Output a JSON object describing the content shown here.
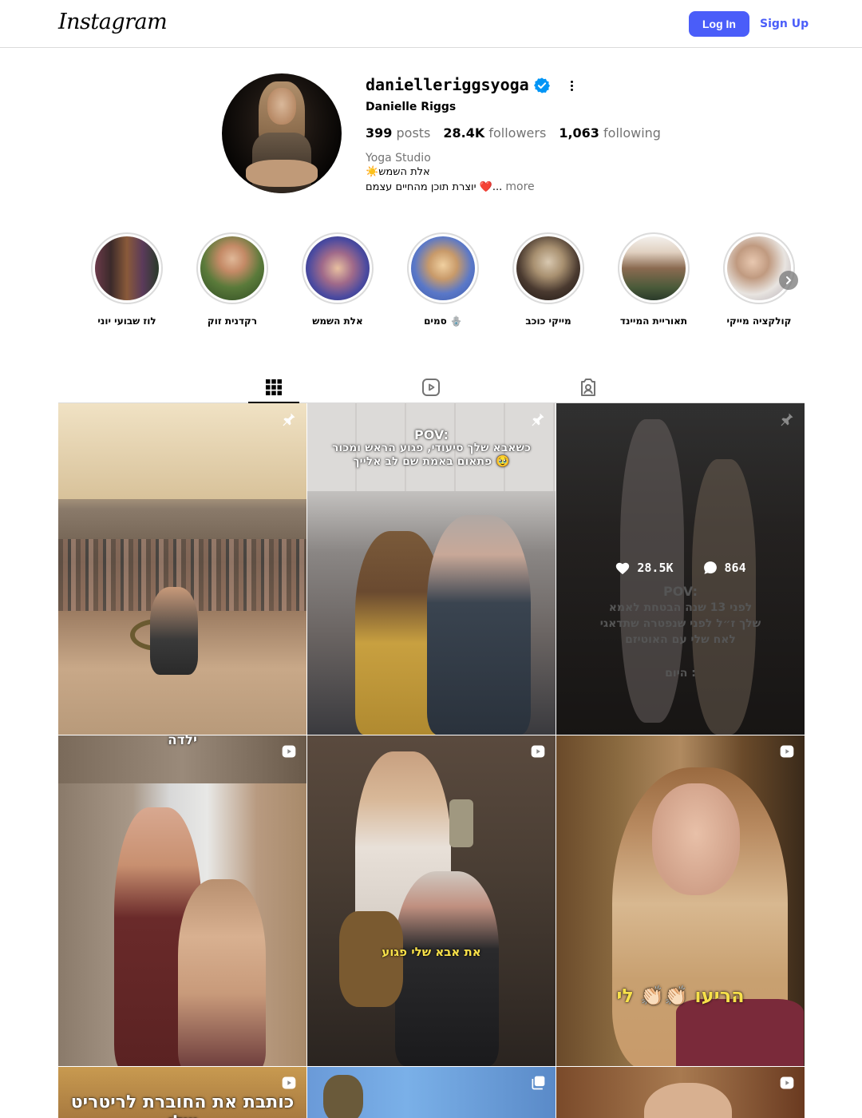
{
  "nav": {
    "logo": "Instagram",
    "login_label": "Log In",
    "signup_label": "Sign Up",
    "accent": "#4a5df9"
  },
  "profile": {
    "username": "danielleriggsyoga",
    "verified_icon": "verified-badge-icon",
    "full_name": "Danielle Riggs",
    "posts_count": "399",
    "posts_label": "posts",
    "followers_count": "28.4K",
    "followers_label": "followers",
    "following_count": "1,063",
    "following_label": "following",
    "category": "Yoga Studio",
    "bio_line1": "☀️אלת השמש",
    "bio_line2": "יוצרת תוכן מהחיים עצמם ❤️...",
    "bio_more": "more"
  },
  "highlights": [
    {
      "label": "לוז שבועי יוני"
    },
    {
      "label": "רקדנית זוק"
    },
    {
      "label": "אלת השמש"
    },
    {
      "label": "סמים 🪬"
    },
    {
      "label": "מייקי כוכב"
    },
    {
      "label": "תאוריית המיינד"
    },
    {
      "label": "קולקציה מייקי"
    }
  ],
  "tabs": [
    {
      "icon": "grid-icon",
      "active": true
    },
    {
      "icon": "reels-icon",
      "active": false
    },
    {
      "icon": "tagged-icon",
      "active": false
    }
  ],
  "posts": [
    {
      "type": "pinned",
      "overlay": ""
    },
    {
      "type": "pinned",
      "overlay_title": "POV:",
      "overlay": "כשאבא שלך סיעודי, פגוע הראש ומכור פתאום באמת שם לב אלייך 🥹"
    },
    {
      "type": "pinned",
      "likes": "28.5K",
      "comments": "864",
      "overlay_title": "POV:",
      "overlay": "לפני 13 שנה הבטחת לאמא שלך ז״ל לפני שנפטרה שתדאגי לאח שלי עם האוטיזם",
      "overlay_after": "היום :"
    },
    {
      "type": "reel",
      "overlay": "ילדה"
    },
    {
      "type": "reel",
      "overlay": "את אבא שלי פגוע"
    },
    {
      "type": "reel",
      "overlay": "הריעו 👏🏻👏🏻 לי"
    },
    {
      "type": "reel",
      "overlay": "כותבת את החוברת לריטריט שלי"
    },
    {
      "type": "carousel",
      "overlay": ""
    },
    {
      "type": "reel",
      "overlay": ""
    }
  ]
}
